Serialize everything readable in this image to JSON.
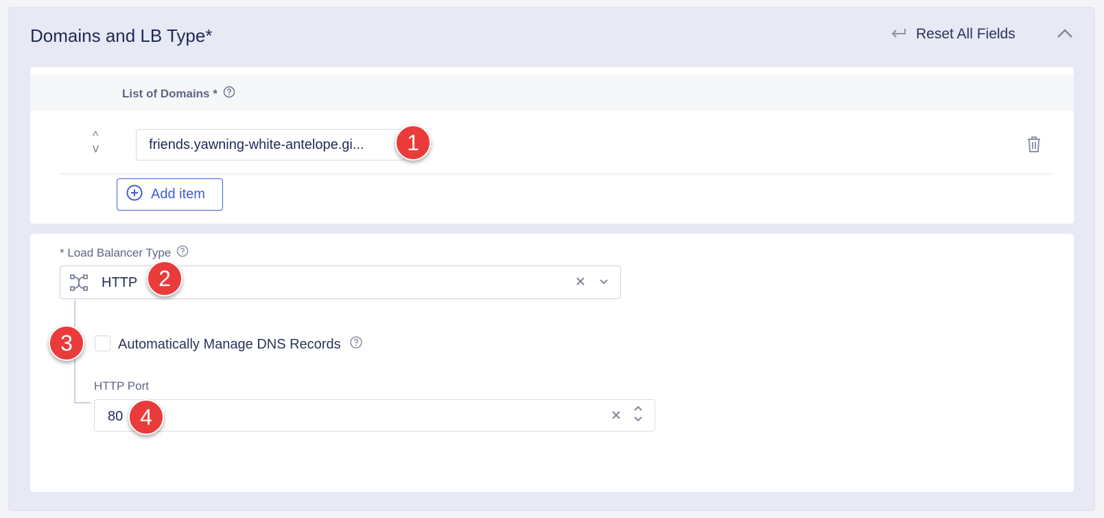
{
  "section": {
    "title": "Domains and LB Type",
    "required_mark": "*",
    "reset_label": "Reset All Fields"
  },
  "domains": {
    "header_label": "List of Domains *",
    "items": [
      {
        "value": "friends.yawning-white-antelope.gi..."
      }
    ],
    "add_label": "Add item"
  },
  "load_balancer": {
    "label": "* Load Balancer Type",
    "selected": "HTTP",
    "dns_label": "Automatically Manage DNS Records",
    "dns_checked": false,
    "port_label": "HTTP Port",
    "port_value": "80"
  },
  "markers": [
    "1",
    "2",
    "3",
    "4"
  ],
  "colors": {
    "accent": "#3f5bd9",
    "marker": "#ea3b3b",
    "section_bg": "#e7e9f4"
  }
}
